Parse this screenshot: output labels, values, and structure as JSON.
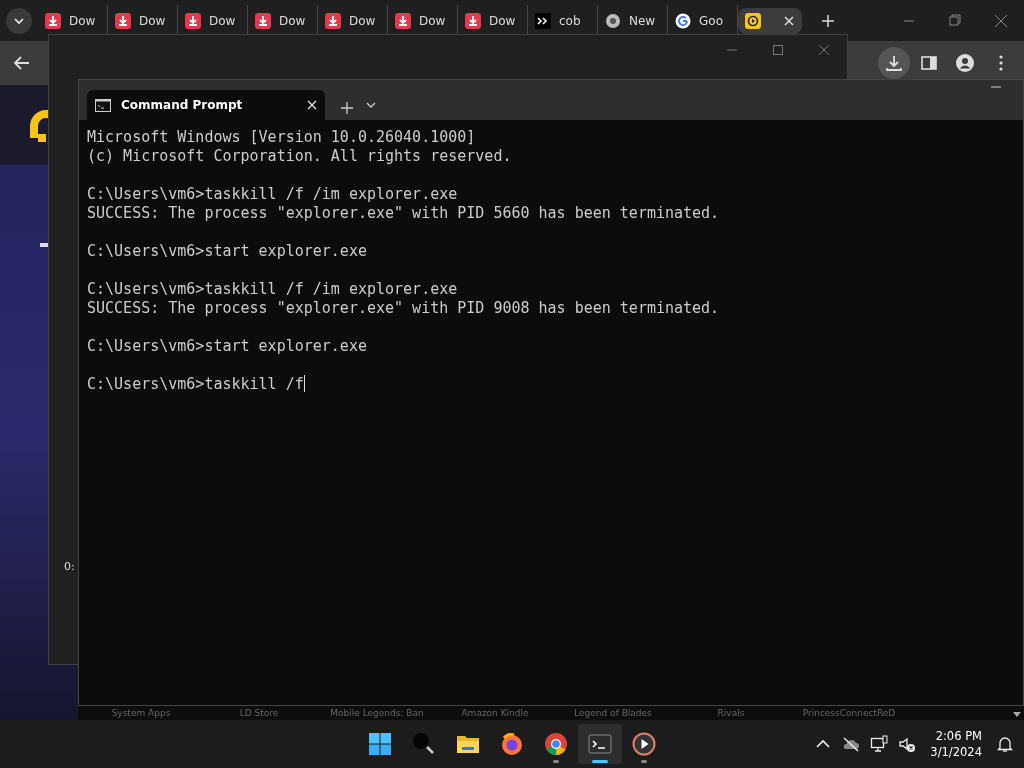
{
  "browser": {
    "tabs": [
      {
        "kind": "download",
        "label": "Dow",
        "selected": false
      },
      {
        "kind": "download",
        "label": "Dow",
        "selected": false
      },
      {
        "kind": "download",
        "label": "Dow",
        "selected": false
      },
      {
        "kind": "download",
        "label": "Dow",
        "selected": false
      },
      {
        "kind": "download",
        "label": "Dow",
        "selected": false
      },
      {
        "kind": "download",
        "label": "Dow",
        "selected": false
      },
      {
        "kind": "download",
        "label": "Dow",
        "selected": false
      },
      {
        "kind": "prompt",
        "label": "cob",
        "selected": false
      },
      {
        "kind": "chrome",
        "label": "New",
        "selected": false
      },
      {
        "kind": "google",
        "label": "Goo",
        "selected": false
      },
      {
        "kind": "player",
        "selected": true
      }
    ],
    "page": {
      "timestamp": "0:",
      "shelf_labels": [
        "System Apps",
        "LD Store",
        "Mobile Legends: Ban",
        "Amazon Kindle",
        "Legend of Blades",
        "Rivals",
        "PrincessConnectReD"
      ]
    }
  },
  "terminal": {
    "tab_title": "Command Prompt",
    "blocks": [
      [
        "Microsoft Windows [Version 10.0.26040.1000]",
        "(c) Microsoft Corporation. All rights reserved."
      ],
      [
        "C:\\Users\\vm6>taskkill /f /im explorer.exe",
        "SUCCESS: The process \"explorer.exe\" with PID 5660 has been terminated."
      ],
      [
        "C:\\Users\\vm6>start explorer.exe"
      ],
      [
        "C:\\Users\\vm6>taskkill /f /im explorer.exe",
        "SUCCESS: The process \"explorer.exe\" with PID 9008 has been terminated."
      ],
      [
        "C:\\Users\\vm6>start explorer.exe"
      ],
      [
        "C:\\Users\\vm6>taskkill /f"
      ]
    ],
    "cursor": true
  },
  "taskbar": {
    "apps": [
      {
        "kind": "start",
        "running": false,
        "selected": false
      },
      {
        "kind": "search",
        "running": false,
        "selected": false
      },
      {
        "kind": "folder",
        "running": false,
        "selected": false
      },
      {
        "kind": "firefox",
        "running": false,
        "selected": false
      },
      {
        "kind": "chrome",
        "running": true,
        "selected": false
      },
      {
        "kind": "terminal",
        "running": true,
        "selected": true
      },
      {
        "kind": "player",
        "running": true,
        "selected": false
      }
    ],
    "clock": {
      "time": "2:06 PM",
      "date": "3/1/2024"
    }
  }
}
